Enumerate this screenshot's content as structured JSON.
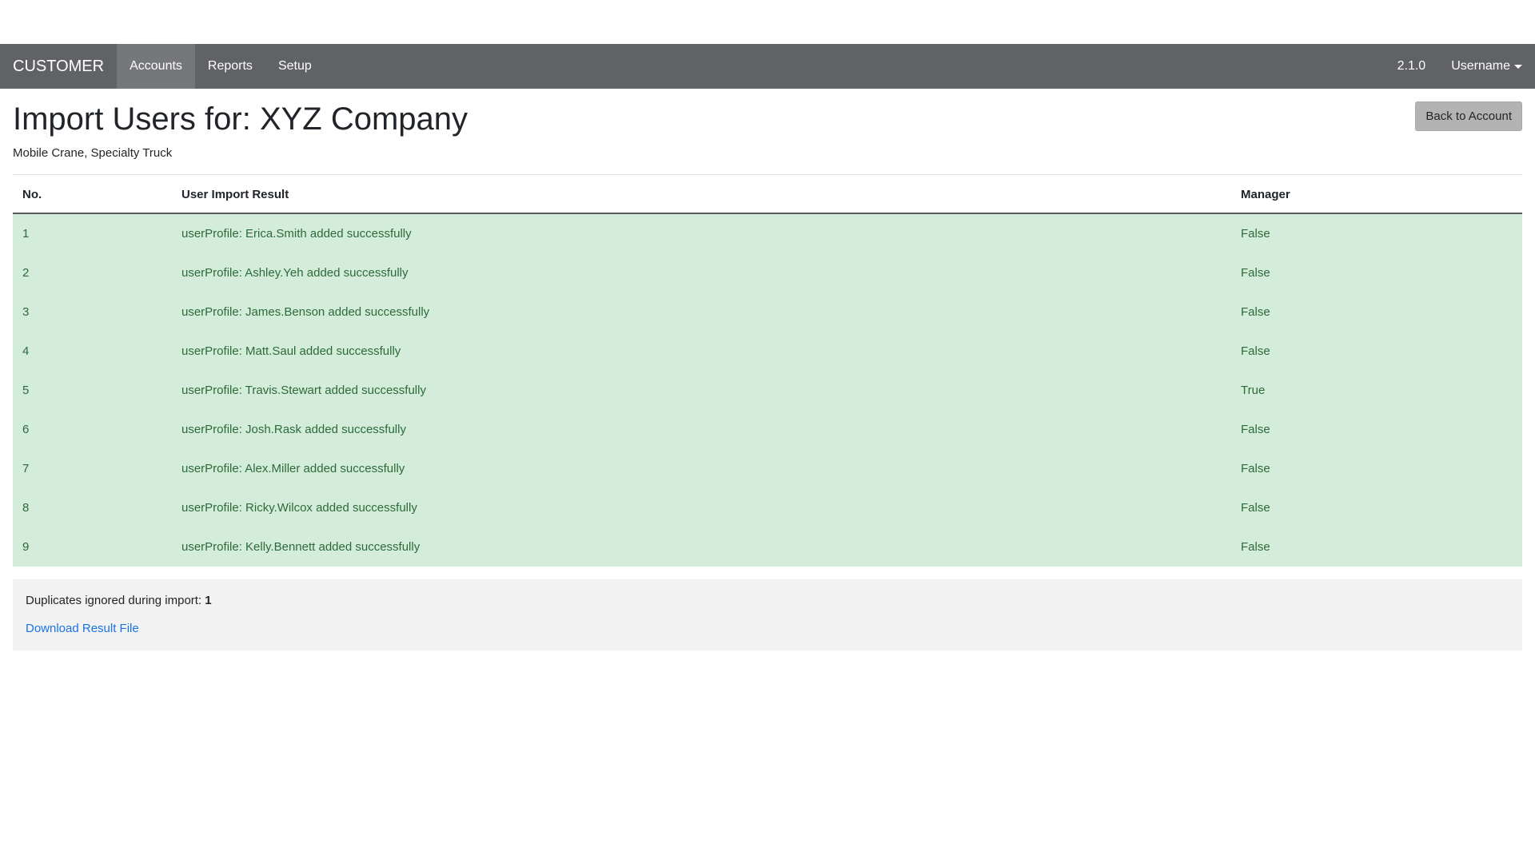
{
  "navbar": {
    "brand": "CUSTOMER",
    "links": [
      {
        "label": "Accounts",
        "active": true
      },
      {
        "label": "Reports",
        "active": false
      },
      {
        "label": "Setup",
        "active": false
      }
    ],
    "version": "2.1.0",
    "user_menu_label": "Username"
  },
  "page": {
    "title": "Import Users for: XYZ Company",
    "subtitle": "Mobile Crane, Specialty Truck",
    "back_button_label": "Back to Account"
  },
  "table": {
    "headers": [
      "No.",
      "User Import Result",
      "Manager"
    ],
    "rows": [
      {
        "no": "1",
        "result": "userProfile: Erica.Smith added successfully",
        "manager": "False"
      },
      {
        "no": "2",
        "result": "userProfile: Ashley.Yeh added successfully",
        "manager": "False"
      },
      {
        "no": "3",
        "result": "userProfile: James.Benson added successfully",
        "manager": "False"
      },
      {
        "no": "4",
        "result": "userProfile: Matt.Saul added successfully",
        "manager": "False"
      },
      {
        "no": "5",
        "result": "userProfile: Travis.Stewart added successfully",
        "manager": "True"
      },
      {
        "no": "6",
        "result": "userProfile: Josh.Rask added successfully",
        "manager": "False"
      },
      {
        "no": "7",
        "result": "userProfile: Alex.Miller added successfully",
        "manager": "False"
      },
      {
        "no": "8",
        "result": "userProfile: Ricky.Wilcox added successfully",
        "manager": "False"
      },
      {
        "no": "9",
        "result": "userProfile: Kelly.Bennett added successfully",
        "manager": "False"
      }
    ]
  },
  "summary": {
    "duplicates_label": "Duplicates ignored during import:",
    "duplicates_count": "1",
    "download_link_label": "Download Result File"
  },
  "colors": {
    "navbar_bg": "#616265",
    "success_row_bg": "#d4edda",
    "success_text": "#2d6a3a",
    "link": "#1a73e8"
  }
}
